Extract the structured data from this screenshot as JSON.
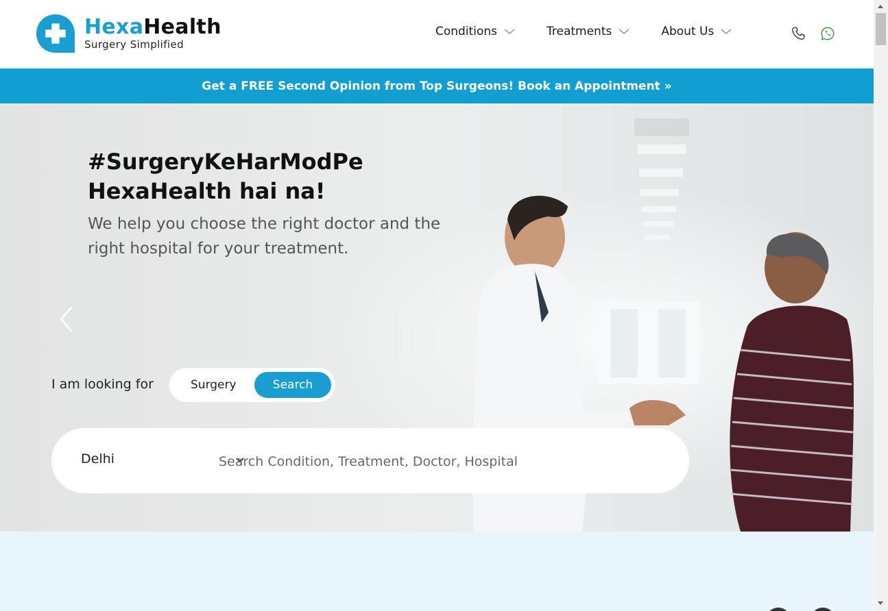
{
  "brand": {
    "name_part1": "Hexa",
    "name_part2": "Health",
    "tagline": "Surgery Simplified",
    "accent_color": "#1b9ed3"
  },
  "nav": {
    "items": [
      {
        "label": "Conditions"
      },
      {
        "label": "Treatments"
      },
      {
        "label": "About Us"
      }
    ]
  },
  "header_icons": {
    "phone": "phone-icon",
    "whatsapp": "whatsapp-icon"
  },
  "banner": {
    "text": "Get a FREE Second Opinion from Top Surgeons! Book an Appointment »",
    "color": "#109fd0"
  },
  "hero": {
    "title": "#SurgeryKeHarModPe HexaHealth hai na!",
    "subtitle": "We help you choose the right doctor and the right hospital for your treatment."
  },
  "search": {
    "looking_for_label": "I am looking for",
    "toggle": {
      "option1": "Surgery",
      "option2": "Search",
      "selected": "Search"
    },
    "city": "Delhi",
    "placeholder": "Search Condition, Treatment, Doctor, Hospital"
  }
}
